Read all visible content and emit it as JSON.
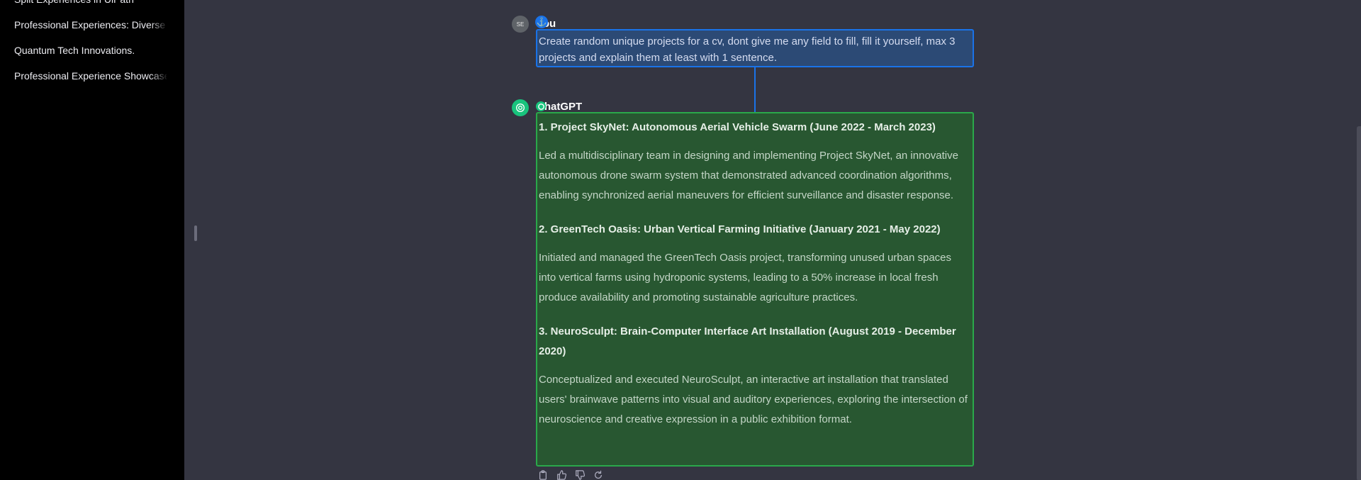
{
  "sidebar": {
    "items": [
      {
        "label": "Split Experiences in UiPath"
      },
      {
        "label": "Professional Experiences: Diverse Expertise"
      },
      {
        "label": "Quantum Tech Innovations."
      },
      {
        "label": "Professional Experience Showcase"
      }
    ]
  },
  "chat": {
    "user": {
      "avatar_initials": "SE",
      "author": "You",
      "message": "Create random unique projects for a cv, dont give me any field to fill, fill it yourself,  max 3 projects and explain them at least with 1 sentence."
    },
    "assistant": {
      "author": "ChatGPT",
      "projects": [
        {
          "title": "1. Project SkyNet: Autonomous Aerial Vehicle Swarm (June 2022 - March 2023)",
          "description": "Led a multidisciplinary team in designing and implementing Project SkyNet, an innovative autonomous drone swarm system that demonstrated advanced coordination algorithms, enabling synchronized aerial maneuvers for efficient surveillance and disaster response."
        },
        {
          "title": "2. GreenTech Oasis: Urban Vertical Farming Initiative (January 2021 - May 2022)",
          "description": "Initiated and managed the GreenTech Oasis project, transforming unused urban spaces into vertical farms using hydroponic systems, leading to a 50% increase in local fresh produce availability and promoting sustainable agriculture practices."
        },
        {
          "title": "3. NeuroSculpt: Brain-Computer Interface Art Installation (August 2019 - December 2020)",
          "description": "Conceptualized and executed NeuroSculpt, an interactive art installation that translated users' brainwave patterns into visual and auditory experiences, exploring the intersection of neuroscience and creative expression in a public exhibition format."
        }
      ]
    },
    "actions": [
      "copy-icon",
      "thumbs-up-icon",
      "thumbs-down-icon",
      "regenerate-icon"
    ]
  },
  "colors": {
    "sidebar_bg": "#000000",
    "main_bg": "#343541",
    "user_highlight": "#1a73e8",
    "assistant_highlight": "#2aa84a",
    "gpt_green": "#19c37d"
  }
}
